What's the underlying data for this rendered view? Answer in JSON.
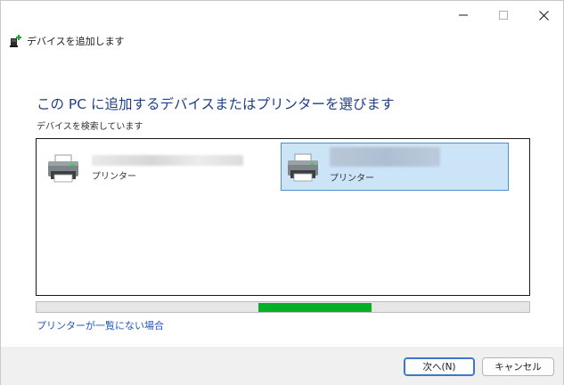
{
  "window": {
    "title": "デバイスを追加します"
  },
  "main": {
    "heading": "この PC に追加するデバイスまたはプリンターを選びます",
    "status": "デバイスを検索しています",
    "devices": [
      {
        "type": "プリンター",
        "selected": false
      },
      {
        "type": "プリンター",
        "selected": true
      }
    ],
    "progress": {
      "start_fraction": 0.45,
      "end_fraction": 0.68,
      "color": "#06b025"
    },
    "link_missing": "プリンターが一覧にない場合"
  },
  "footer": {
    "next_label": "次へ(N)",
    "cancel_label": "キャンセル"
  },
  "icons": {
    "title_icon": "add-device-icon",
    "device_icon": "printer-icon"
  }
}
